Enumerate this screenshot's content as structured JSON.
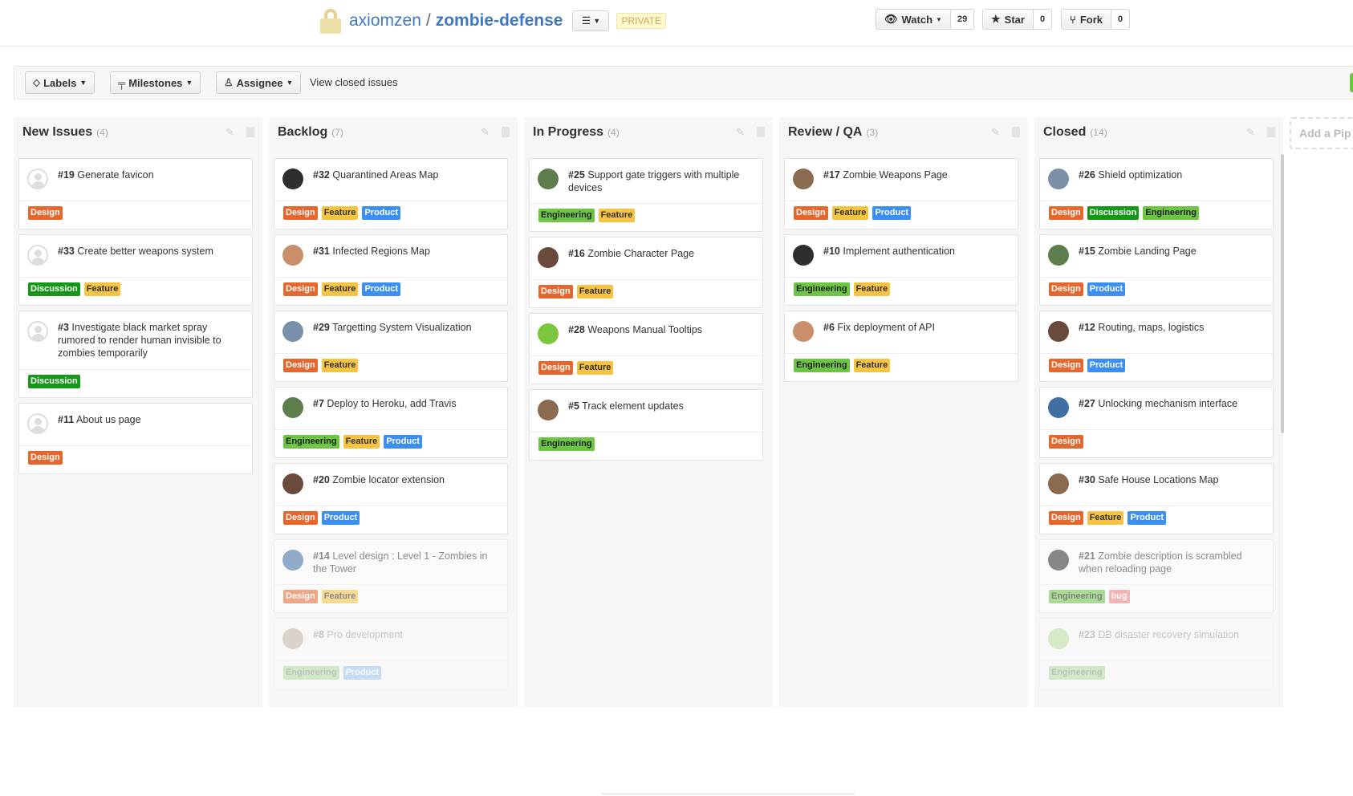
{
  "header": {
    "owner": "axiomzen",
    "separator": "/",
    "repo": "zombie-defense",
    "list_icon": "list-icon",
    "private_badge": "PRIVATE",
    "watch": {
      "label": "Watch",
      "count": "29"
    },
    "star": {
      "label": "Star",
      "count": "0"
    },
    "fork": {
      "label": "Fork",
      "count": "0"
    }
  },
  "filters": {
    "labels": "Labels",
    "milestones": "Milestones",
    "assignee": "Assignee",
    "closed_link": "View closed issues"
  },
  "add_pipeline": "Add a Pip",
  "columns": [
    {
      "title": "New Issues",
      "count": "(4)",
      "cards": [
        {
          "num": "#19",
          "title": "Generate favicon",
          "labels": [
            "Design"
          ]
        },
        {
          "num": "#33",
          "title": "Create better weapons system",
          "labels": [
            "Discussion",
            "Feature"
          ]
        },
        {
          "num": "#3",
          "title": "Investigate black market spray rumored to render human invisible to zombies temporarily",
          "labels": [
            "Discussion"
          ]
        },
        {
          "num": "#11",
          "title": "About us page",
          "labels": [
            "Design"
          ]
        }
      ]
    },
    {
      "title": "Backlog",
      "count": "(7)",
      "cards": [
        {
          "num": "#32",
          "title": "Quarantined Areas Map",
          "labels": [
            "Design",
            "Feature",
            "Product"
          ]
        },
        {
          "num": "#31",
          "title": "Infected Regions Map",
          "labels": [
            "Design",
            "Feature",
            "Product"
          ]
        },
        {
          "num": "#29",
          "title": "Targetting System Visualization",
          "labels": [
            "Design",
            "Feature"
          ]
        },
        {
          "num": "#7",
          "title": "Deploy to Heroku, add Travis",
          "labels": [
            "Engineering",
            "Feature",
            "Product"
          ]
        },
        {
          "num": "#20",
          "title": "Zombie locator extension",
          "labels": [
            "Design",
            "Product"
          ]
        },
        {
          "num": "#14",
          "title": "Level design : Level 1 - Zombies in the Tower",
          "labels": [
            "Design",
            "Feature"
          ]
        },
        {
          "num": "#8",
          "title": "Pro development",
          "labels": [
            "Engineering",
            "Product"
          ]
        }
      ]
    },
    {
      "title": "In Progress",
      "count": "(4)",
      "cards": [
        {
          "num": "#25",
          "title": "Support gate triggers with multiple devices",
          "labels": [
            "Engineering",
            "Feature"
          ]
        },
        {
          "num": "#16",
          "title": "Zombie Character Page",
          "labels": [
            "Design",
            "Feature"
          ]
        },
        {
          "num": "#28",
          "title": "Weapons Manual Tooltips",
          "labels": [
            "Design",
            "Feature"
          ]
        },
        {
          "num": "#5",
          "title": "Track element updates",
          "labels": [
            "Engineering"
          ]
        }
      ]
    },
    {
      "title": "Review / QA",
      "count": "(3)",
      "cards": [
        {
          "num": "#17",
          "title": "Zombie Weapons Page",
          "labels": [
            "Design",
            "Feature",
            "Product"
          ]
        },
        {
          "num": "#10",
          "title": "Implement authentication",
          "labels": [
            "Engineering",
            "Feature"
          ]
        },
        {
          "num": "#6",
          "title": "Fix deployment of API",
          "labels": [
            "Engineering",
            "Feature"
          ]
        }
      ]
    },
    {
      "title": "Closed",
      "count": "(14)",
      "cards": [
        {
          "num": "#26",
          "title": "Shield optimization",
          "labels": [
            "Design",
            "Discussion",
            "Engineering"
          ]
        },
        {
          "num": "#15",
          "title": "Zombie Landing Page",
          "labels": [
            "Design",
            "Product"
          ]
        },
        {
          "num": "#12",
          "title": "Routing, maps, logistics",
          "labels": [
            "Design",
            "Product"
          ]
        },
        {
          "num": "#27",
          "title": "Unlocking mechanism interface",
          "labels": [
            "Design"
          ]
        },
        {
          "num": "#30",
          "title": "Safe House Locations Map",
          "labels": [
            "Design",
            "Feature",
            "Product"
          ]
        },
        {
          "num": "#21",
          "title": "Zombie description is scrambled when reloading page",
          "labels": [
            "Engineering",
            "bug"
          ]
        },
        {
          "num": "#23",
          "title": "DB disaster recovery simulation",
          "labels": [
            "Engineering"
          ]
        }
      ]
    }
  ],
  "colors": {
    "link": "#4078c0",
    "design": "#e6672e",
    "feature": "#f6c342",
    "product": "#3b8ff0",
    "engineering": "#6cc644",
    "discussion": "#159818",
    "bug": "#ef7f7f"
  }
}
